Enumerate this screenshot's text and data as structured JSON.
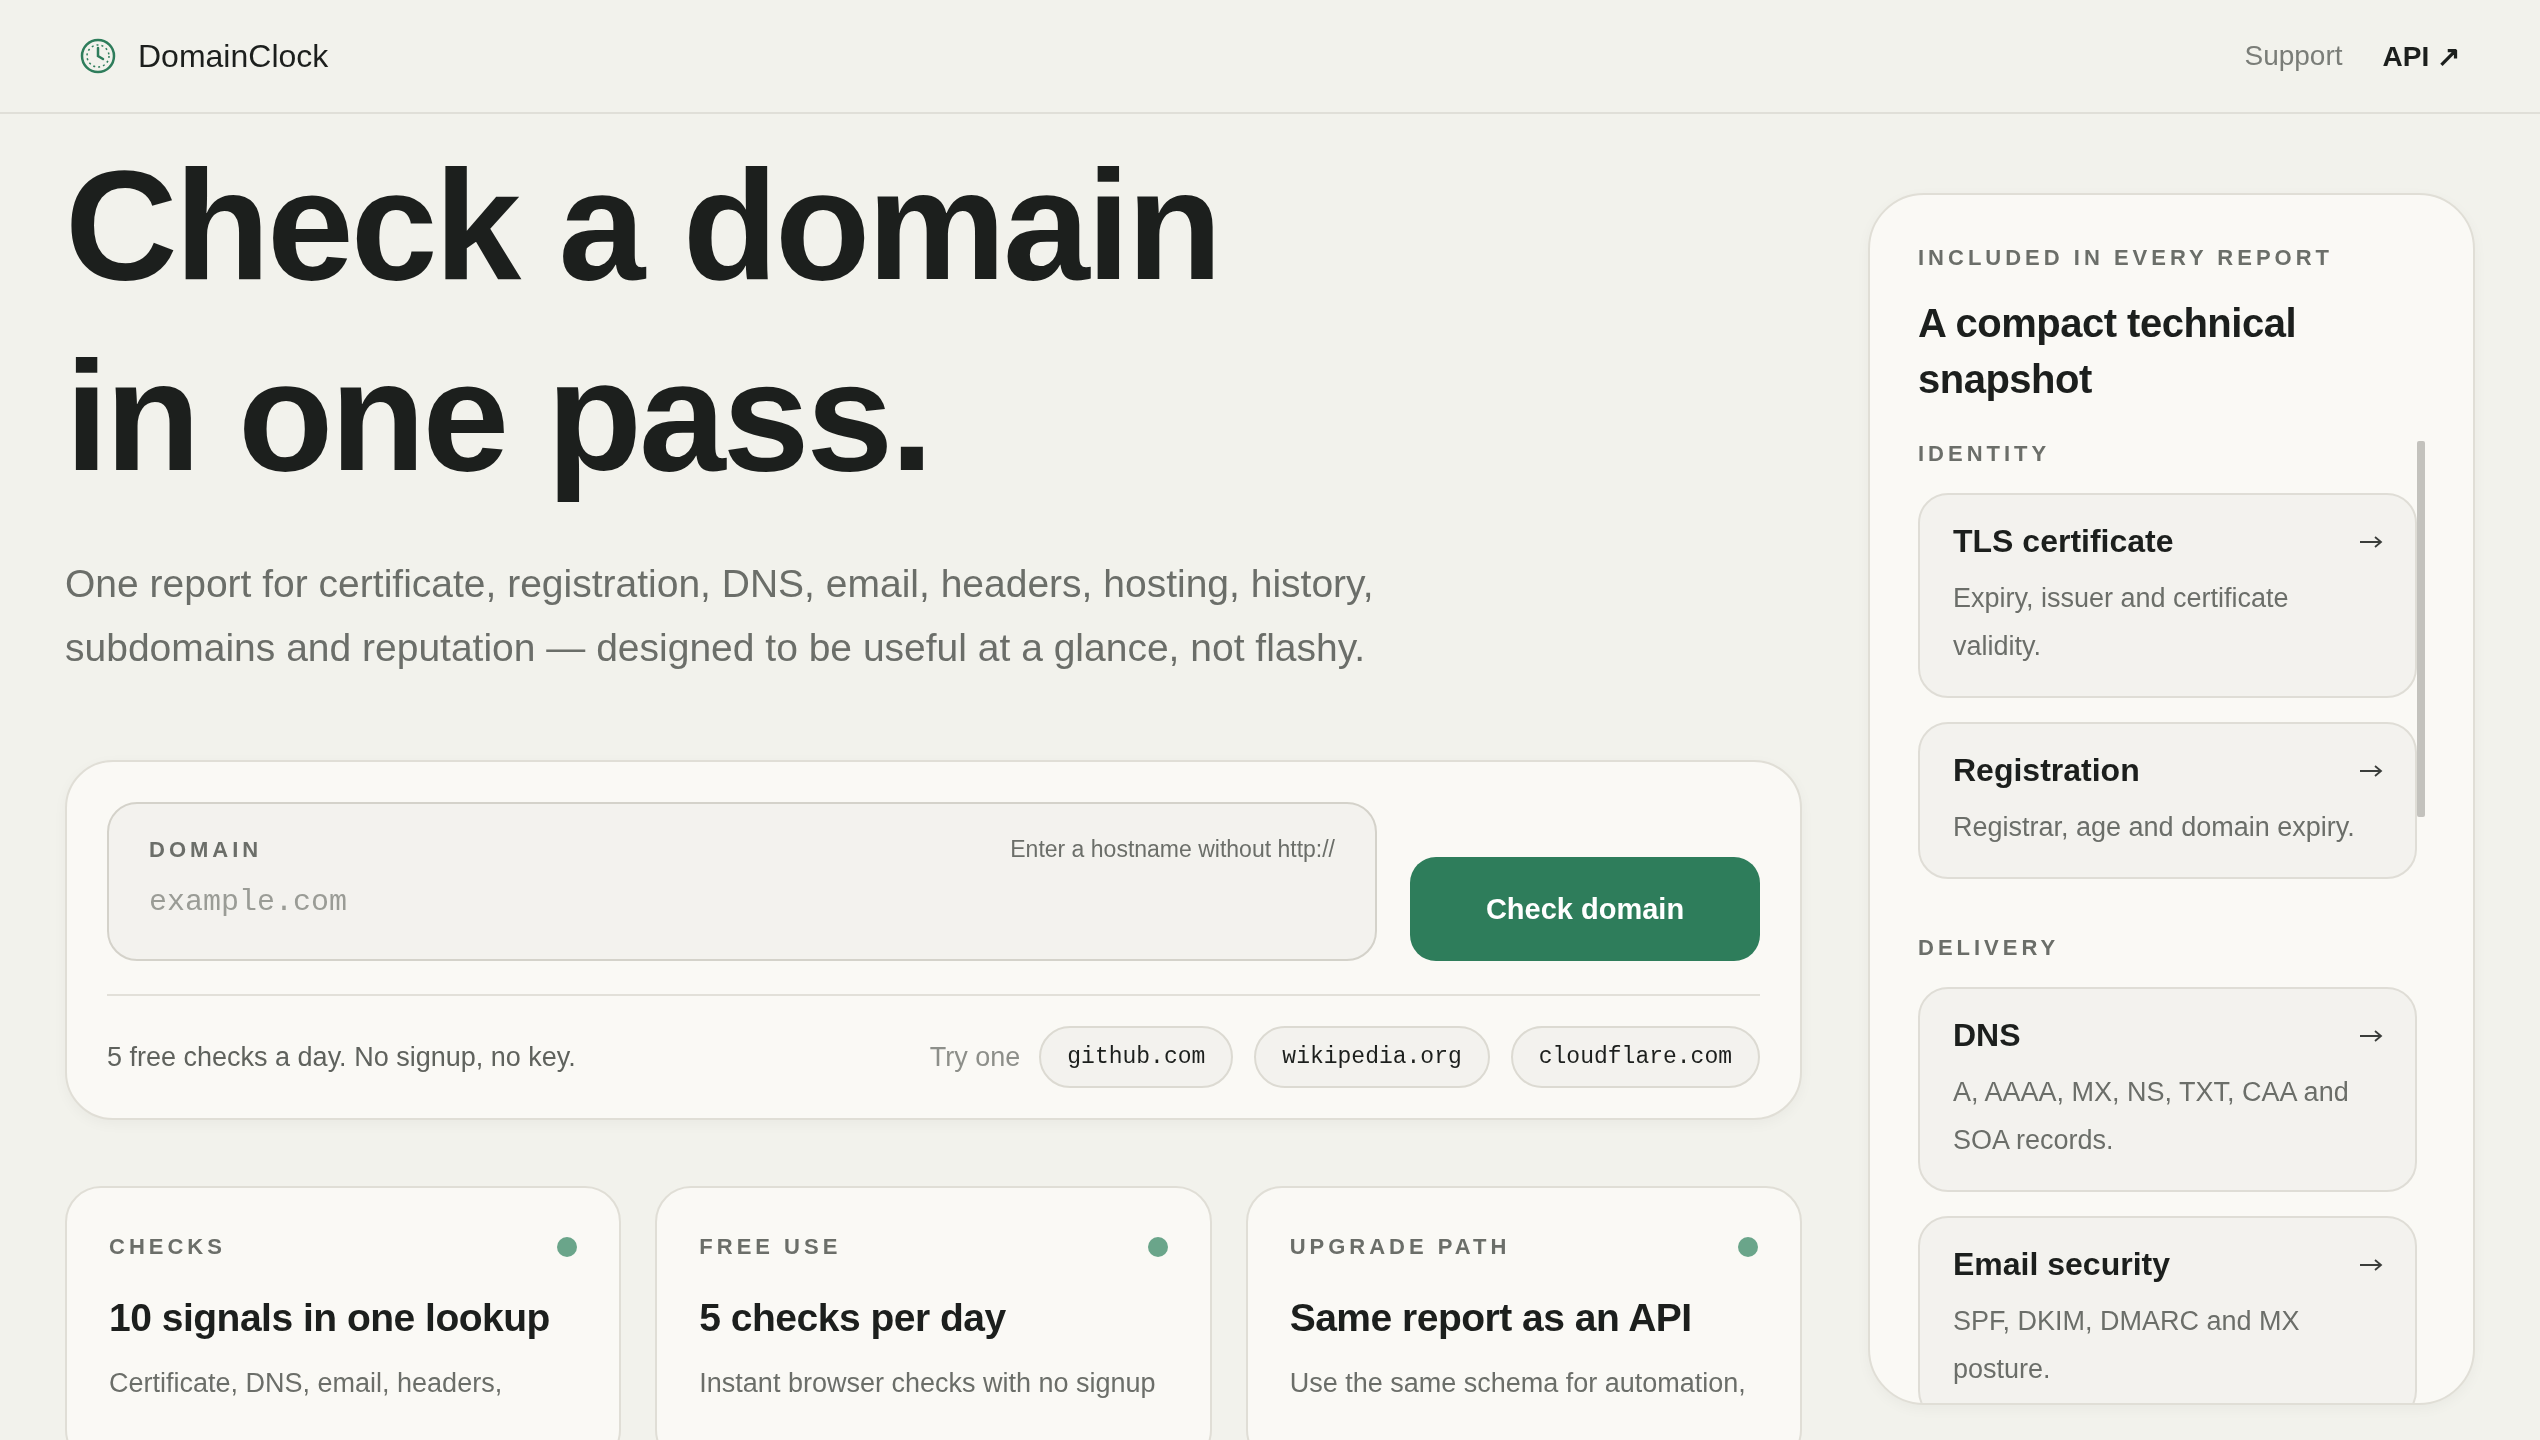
{
  "header": {
    "brand": "DomainClock",
    "nav": [
      {
        "label": "Support",
        "kind": "muted"
      },
      {
        "label": "API ↗",
        "kind": "strong"
      }
    ]
  },
  "hero": {
    "headline_lines": [
      "Check a domain",
      "in one pass."
    ],
    "subtitle_lines": [
      "One report for certificate, registration, DNS, email, headers, hosting, history,",
      "subdomains and reputation — designed to be useful at a glance, not flashy."
    ]
  },
  "search": {
    "field": {
      "label": "DOMAIN",
      "hint": "Enter a hostname without http://",
      "placeholder": "example.com"
    },
    "button": "Check domain",
    "note": "5 free checks a day. No signup, no key.",
    "try_label": "Try one",
    "examples": [
      "github.com",
      "wikipedia.org",
      "cloudflare.com"
    ]
  },
  "features": [
    {
      "eyebrow": "CHECKS",
      "title": "10 signals in one lookup",
      "description": "Certificate, DNS, email, headers,"
    },
    {
      "eyebrow": "FREE USE",
      "title": "5 checks per day",
      "description": "Instant browser checks with no signup"
    },
    {
      "eyebrow": "UPGRADE PATH",
      "title": "Same report as an API",
      "description": "Use the same schema for automation,"
    }
  ],
  "report_panel": {
    "eyebrow": "INCLUDED IN EVERY REPORT",
    "title": "A compact technical snapshot",
    "sections": [
      {
        "heading": "IDENTITY",
        "items": [
          {
            "title": "TLS certificate",
            "description": "Expiry, issuer and certificate validity."
          },
          {
            "title": "Registration",
            "description": "Registrar, age and domain expiry."
          }
        ]
      },
      {
        "heading": "DELIVERY",
        "items": [
          {
            "title": "DNS",
            "description": "A, AAAA, MX, NS, TXT, CAA and SOA records."
          },
          {
            "title": "Email security",
            "description": "SPF, DKIM, DMARC and MX posture."
          }
        ]
      }
    ]
  }
}
